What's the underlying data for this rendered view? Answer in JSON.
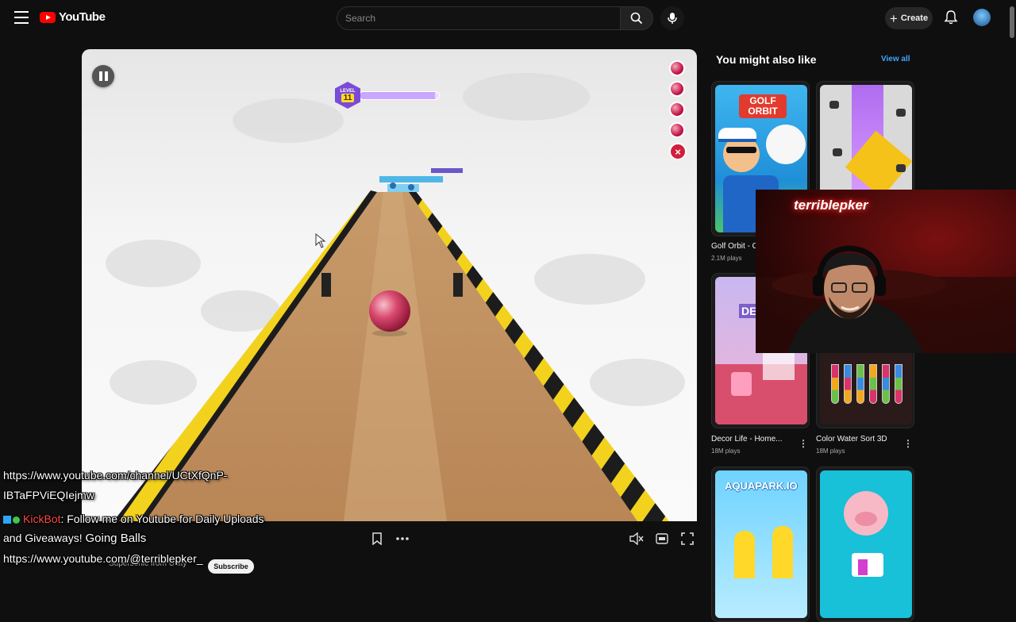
{
  "header": {
    "brand": "YouTube",
    "search_placeholder": "Search",
    "create_label": "Create"
  },
  "game": {
    "level_label": "LEVEL",
    "level_number": "11",
    "lives": 4,
    "level_progress": 0.95
  },
  "sidebar": {
    "title": "You might also like",
    "view_all": "View all",
    "games": [
      {
        "title": "Golf Orbit - Or",
        "plays": "2.1M plays",
        "thumb_text": "GOLF ORBIT"
      },
      {
        "title": "",
        "plays": "",
        "thumb_text": ""
      },
      {
        "title": "Decor Life - Home...",
        "plays": "18M plays",
        "thumb_text": "DE"
      },
      {
        "title": "Color Water Sort 3D",
        "plays": "18M plays",
        "thumb_text": ""
      },
      {
        "title": "",
        "plays": "",
        "thumb_text": "AQUAPARK.IO"
      },
      {
        "title": "",
        "plays": "",
        "thumb_text": ""
      }
    ]
  },
  "webcam": {
    "neon_sign": "terriblepker"
  },
  "overlay": {
    "url_line1": "https://www.youtube.com/channel/UCtXfQnP-",
    "url_line2": "IBTaFPViEQIejmw",
    "bot_name": "KickBot",
    "bot_message": ": Follow me on Youtube for Daily Uploads",
    "line4_prefix": "and Giveaways!",
    "game_title": "Going Balls",
    "url_line5": "https://www.youtube.com/@terriblepker_",
    "channel_mini": "Supersonic from Unity",
    "subscribe_label": "Subscribe"
  }
}
